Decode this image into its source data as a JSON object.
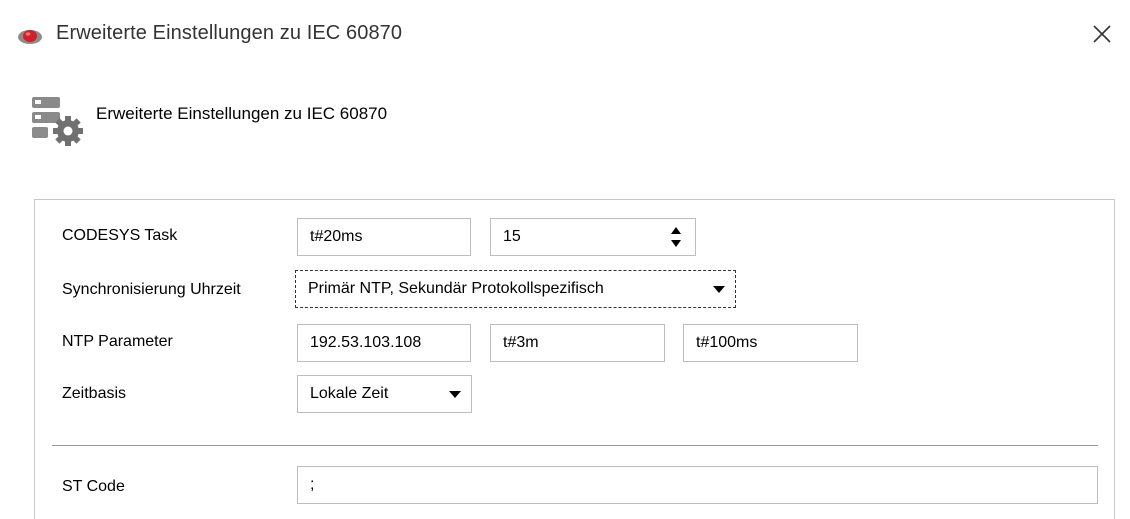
{
  "window": {
    "title": "Erweiterte Einstellungen zu IEC 60870",
    "app_icon": "codesys-device-icon",
    "close_icon": "close-icon",
    "colors": {
      "app_icon_red": "#d0202a",
      "app_icon_grey": "#8c8c8c"
    }
  },
  "header": {
    "title": "Erweiterte Einstellungen zu IEC 60870",
    "icon": "server-settings-icon"
  },
  "form": {
    "codesys_task": {
      "label": "CODESYS Task",
      "interval": "t#20ms",
      "priority": "15"
    },
    "sync_time": {
      "label": "Synchronisierung Uhrzeit",
      "selected": "Primär NTP, Sekundär Protokollspezifisch"
    },
    "ntp": {
      "label": "NTP Parameter",
      "server": "192.53.103.108",
      "interval": "t#3m",
      "timeout": "t#100ms"
    },
    "time_base": {
      "label": "Zeitbasis",
      "selected": "Lokale Zeit"
    },
    "st_code": {
      "label": "ST Code",
      "value": ";"
    }
  }
}
